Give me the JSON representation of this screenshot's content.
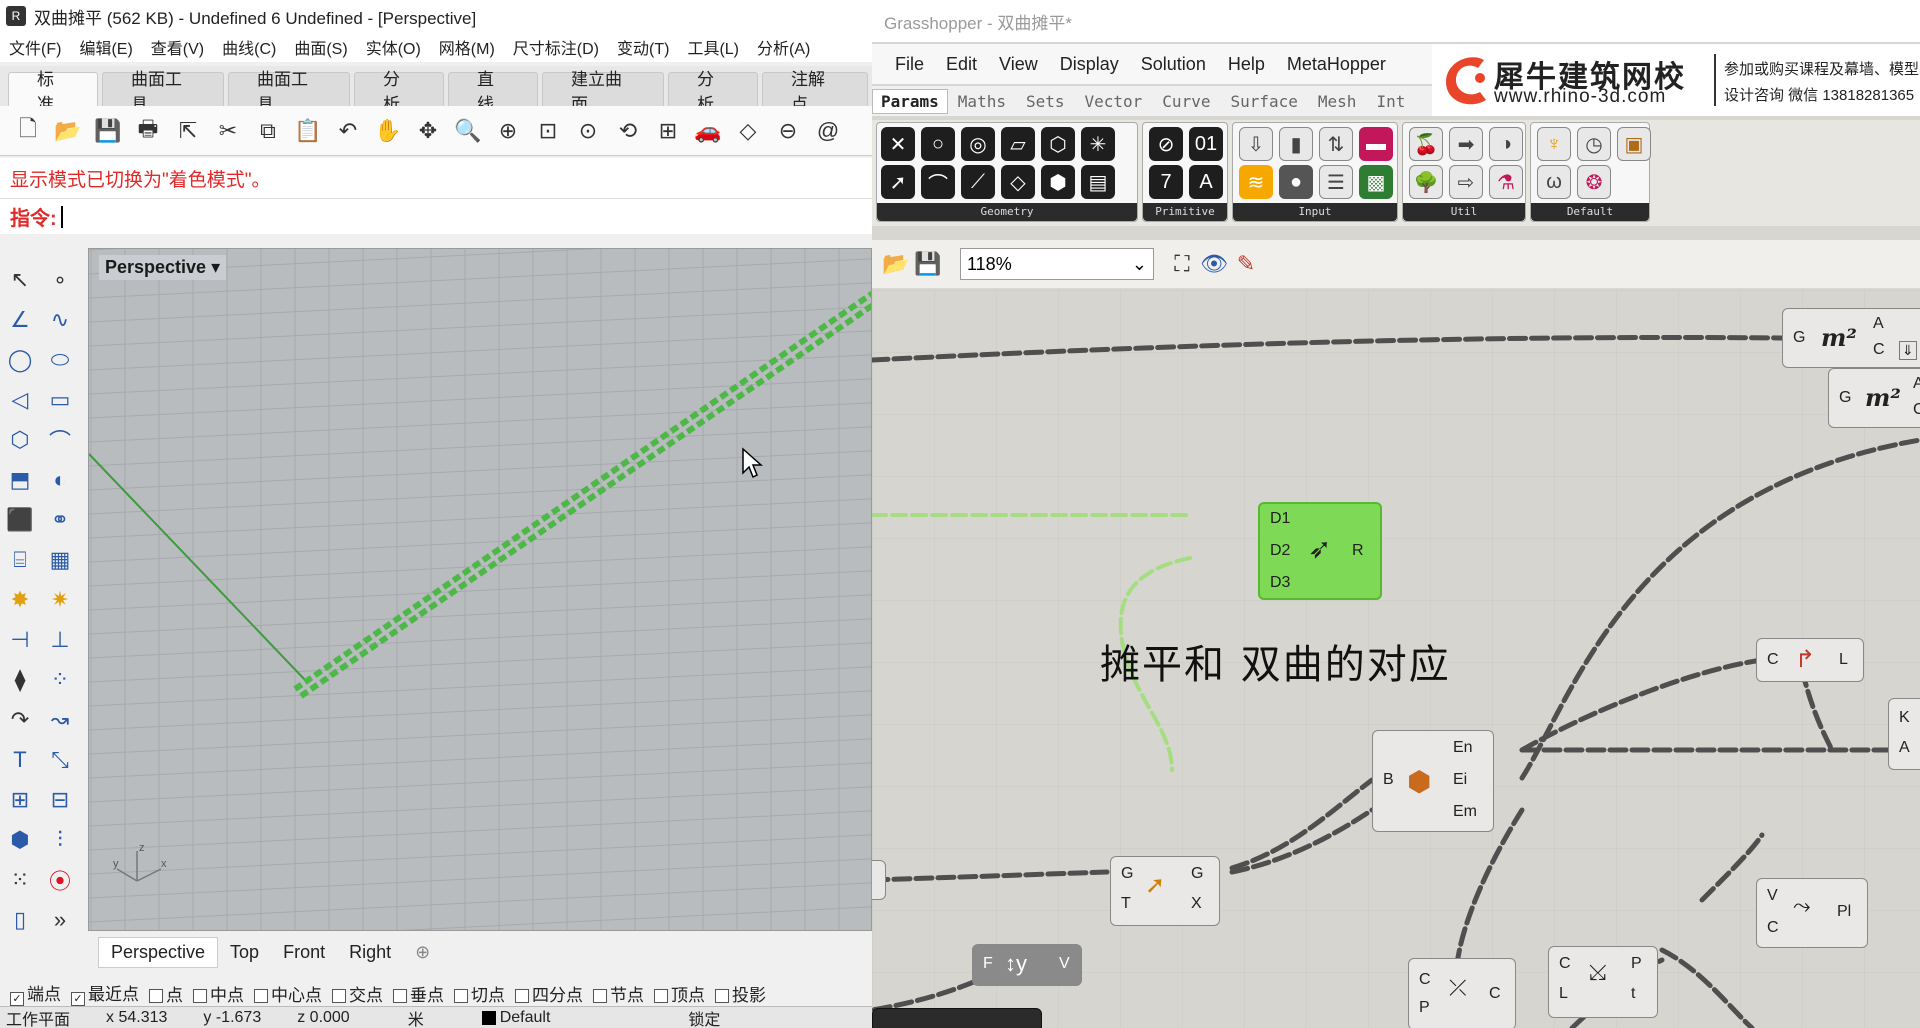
{
  "rhino": {
    "title": "双曲摊平 (562 KB) - Undefined 6 Undefined - [Perspective]",
    "menu": [
      "文件(F)",
      "编辑(E)",
      "查看(V)",
      "曲线(C)",
      "曲面(S)",
      "实体(O)",
      "网格(M)",
      "尺寸标注(D)",
      "变动(T)",
      "工具(L)",
      "分析(A)"
    ],
    "tabs": [
      "标准",
      "曲面工具",
      "曲面工具",
      "分析",
      "直线",
      "建立曲面",
      "分析",
      "注解点"
    ],
    "command_history": "显示模式已切换为\"着色模式\"。",
    "command_prompt": "指令:",
    "viewport_label": "Perspective",
    "viewport_tabs": [
      "Perspective",
      "Top",
      "Front",
      "Right"
    ],
    "osnaps": [
      {
        "label": "端点",
        "checked": true
      },
      {
        "label": "最近点",
        "checked": true
      },
      {
        "label": "点",
        "checked": false
      },
      {
        "label": "中点",
        "checked": false
      },
      {
        "label": "中心点",
        "checked": false
      },
      {
        "label": "交点",
        "checked": false
      },
      {
        "label": "垂点",
        "checked": false
      },
      {
        "label": "切点",
        "checked": false
      },
      {
        "label": "四分点",
        "checked": false
      },
      {
        "label": "节点",
        "checked": false
      },
      {
        "label": "顶点",
        "checked": false
      },
      {
        "label": "投影",
        "checked": false
      }
    ],
    "status": {
      "plane": "工作平面",
      "x": "x 54.313",
      "y": "y -1.673",
      "z": "z 0.000",
      "unit": "米",
      "layer": "Default",
      "lock": "锁定"
    },
    "axis_labels": {
      "x": "x",
      "y": "y",
      "z": "z"
    }
  },
  "gh": {
    "title": "Grasshopper - 双曲摊平*",
    "menu": [
      "File",
      "Edit",
      "View",
      "Display",
      "Solution",
      "Help",
      "MetaHopper"
    ],
    "component_tabs": [
      "Params",
      "Maths",
      "Sets",
      "Vector",
      "Curve",
      "Surface",
      "Mesh",
      "Int"
    ],
    "panels": [
      "Geometry",
      "Primitive",
      "Input",
      "Util",
      "Default"
    ],
    "zoom": "118%",
    "banner": {
      "brand": "犀牛建筑网校",
      "url": "www.rhino-3d.com",
      "promo1": "参加或购买课程及幕墙、模型",
      "promo2": "设计咨询 微信 13818281365"
    },
    "canvas_label": "摊平和 双曲的对应",
    "components": {
      "area1": {
        "in": "G",
        "icon": "m²",
        "out1": "A",
        "out2": "C"
      },
      "area2": {
        "in": "G",
        "icon": "m²",
        "out1": "A",
        "out2": "C"
      },
      "orient": {
        "in1": "D1",
        "in2": "D2",
        "in3": "D3",
        "out": "R"
      },
      "brep": {
        "in": "B",
        "out1": "En",
        "out2": "Ei",
        "out3": "Em"
      },
      "curvelen": {
        "in": "C",
        "out": "L"
      },
      "ka": {
        "out1": "K",
        "out2": "A"
      },
      "transform": {
        "in1": "G",
        "in2": "T",
        "out1": "G",
        "out2": "X"
      },
      "graph": {
        "in": "F",
        "out": "V"
      },
      "plane": {
        "in1": "V",
        "in2": "C",
        "out": "Pl"
      },
      "cp1": {
        "in1": "C",
        "in2": "P",
        "out": "C"
      },
      "cp2": {
        "in1": "C",
        "in2": "L",
        "out1": "P",
        "out2": "t"
      }
    }
  }
}
